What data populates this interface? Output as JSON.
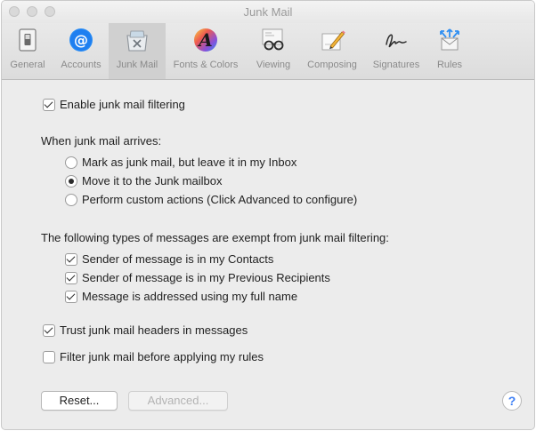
{
  "window": {
    "title": "Junk Mail"
  },
  "toolbar": {
    "items": [
      {
        "label": "General",
        "icon": "switch-icon"
      },
      {
        "label": "Accounts",
        "icon": "at-sign-icon"
      },
      {
        "label": "Junk Mail",
        "icon": "junk-mail-tray-icon",
        "selected": true
      },
      {
        "label": "Fonts & Colors",
        "icon": "fonts-colors-icon"
      },
      {
        "label": "Viewing",
        "icon": "glasses-icon"
      },
      {
        "label": "Composing",
        "icon": "pencil-paper-icon"
      },
      {
        "label": "Signatures",
        "icon": "signature-icon"
      },
      {
        "label": "Rules",
        "icon": "rules-envelope-icon"
      }
    ]
  },
  "settings": {
    "enable_filtering": {
      "label": "Enable junk mail filtering",
      "checked": true
    },
    "arrival_heading": "When junk mail arrives:",
    "arrival_options": [
      {
        "label": "Mark as junk mail, but leave it in my Inbox",
        "selected": false
      },
      {
        "label": "Move it to the Junk mailbox",
        "selected": true
      },
      {
        "label": "Perform custom actions (Click Advanced to configure)",
        "selected": false
      }
    ],
    "exempt_heading": "The following types of messages are exempt from junk mail filtering:",
    "exempt_options": [
      {
        "label": "Sender of message is in my Contacts",
        "checked": true
      },
      {
        "label": "Sender of message is in my Previous Recipients",
        "checked": true
      },
      {
        "label": "Message is addressed using my full name",
        "checked": true
      }
    ],
    "trust_headers": {
      "label": "Trust junk mail headers in messages",
      "checked": true
    },
    "filter_before_rules": {
      "label": "Filter junk mail before applying my rules",
      "checked": false
    }
  },
  "buttons": {
    "reset": "Reset...",
    "advanced": "Advanced...",
    "help": "?"
  },
  "colors": {
    "accent": "#3d7ff5",
    "panel": "#ececec"
  }
}
